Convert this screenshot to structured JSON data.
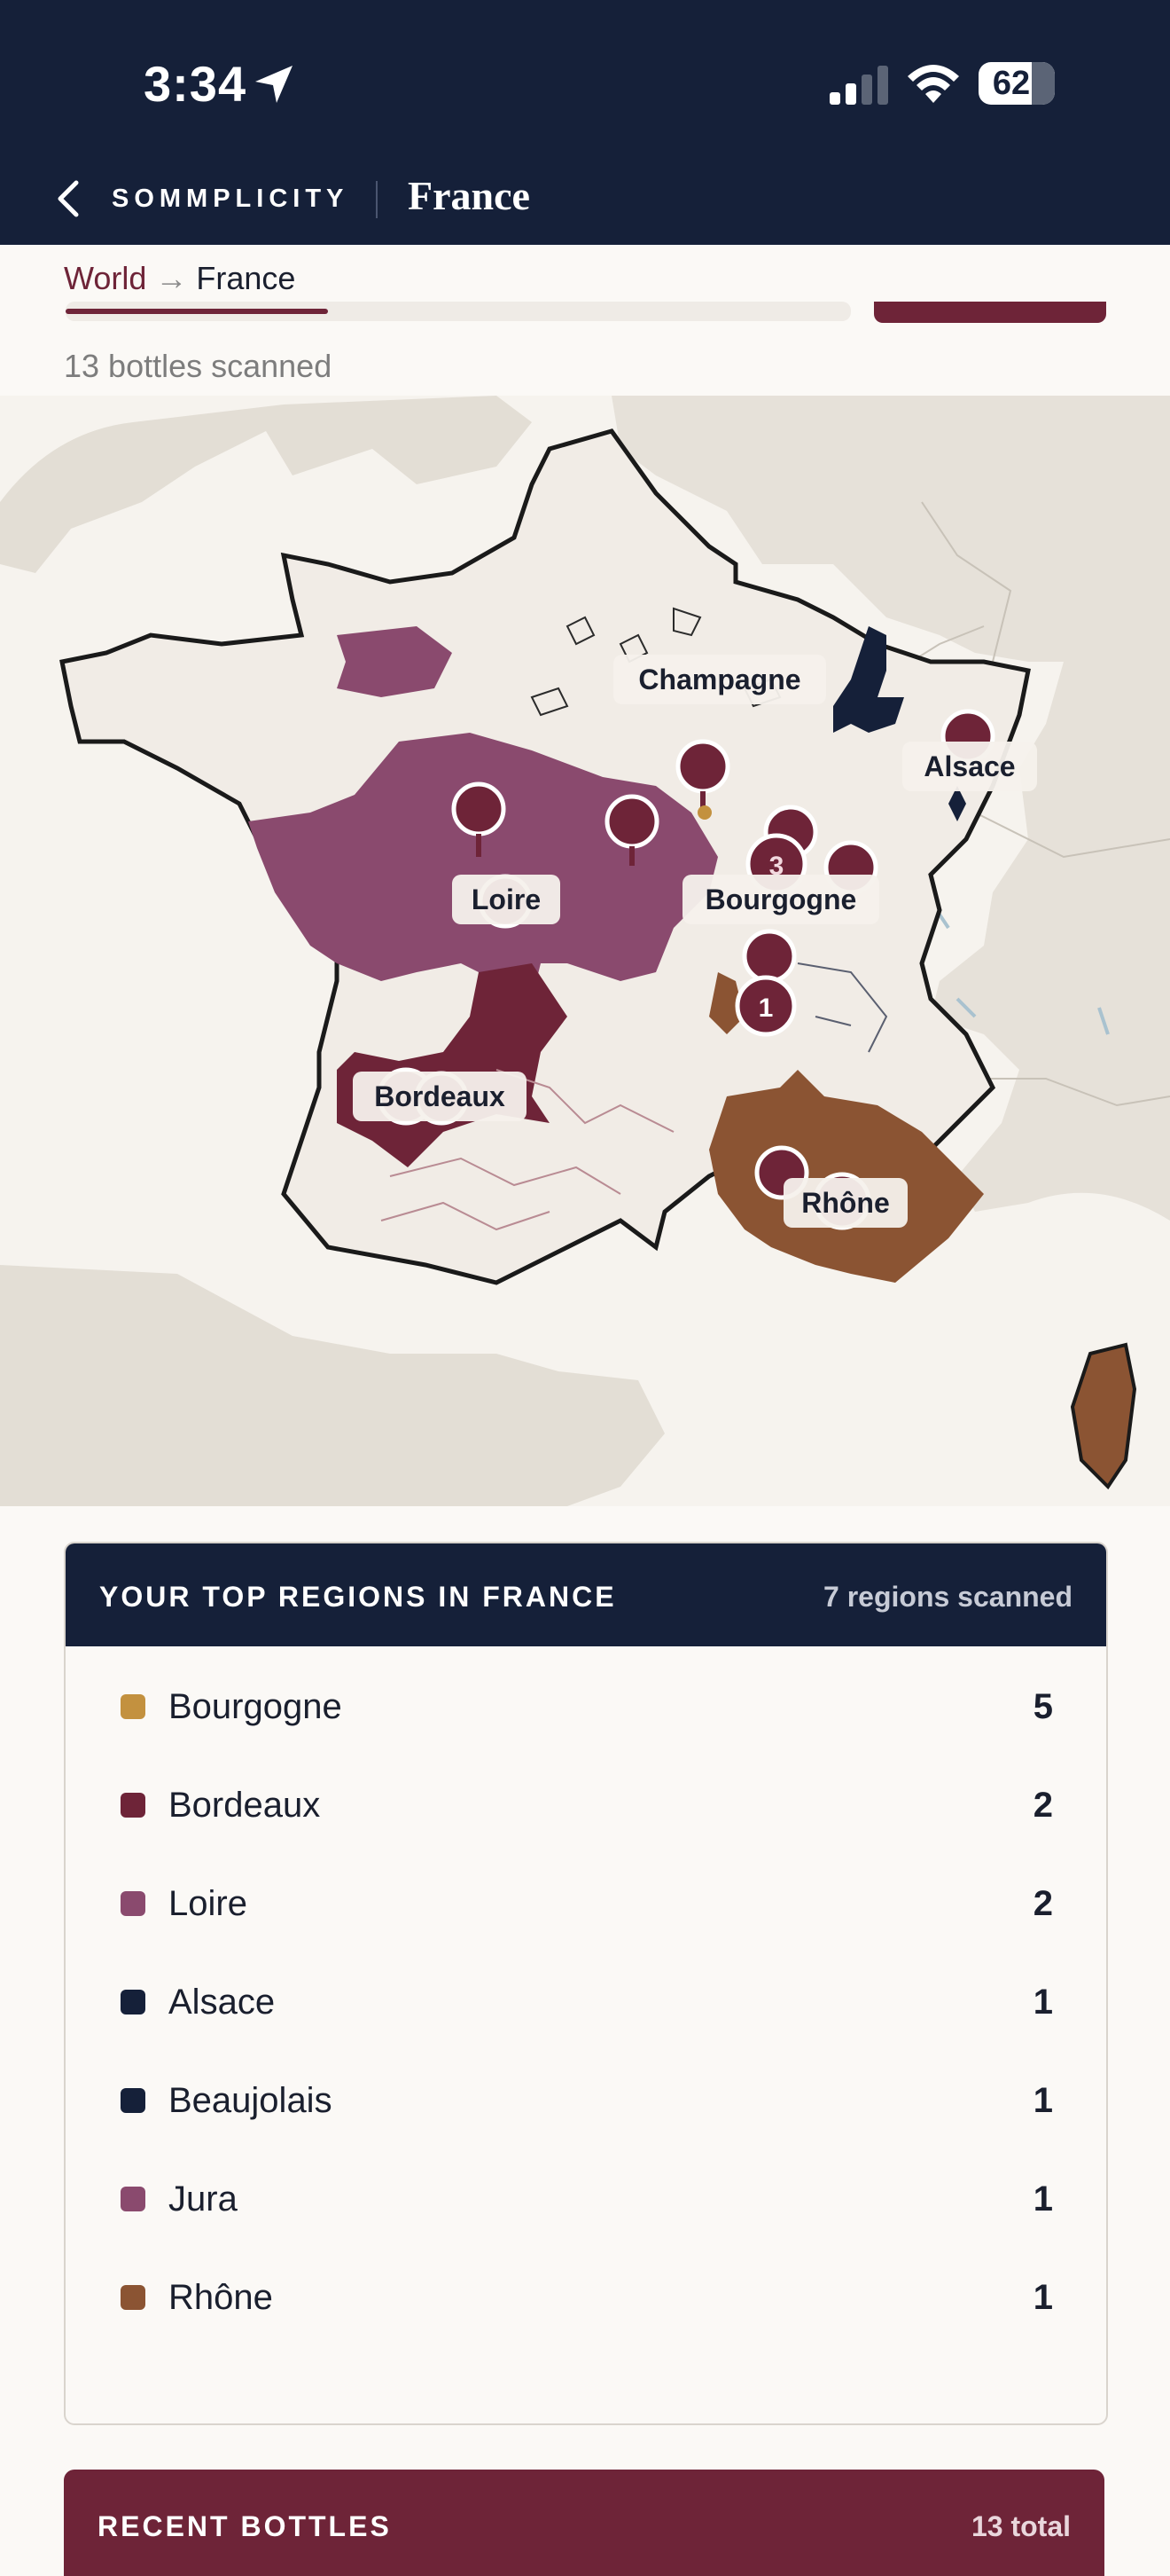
{
  "status_bar": {
    "time": "3:34",
    "battery": "62"
  },
  "nav": {
    "brand": "SOMMPLICITY",
    "title": "France"
  },
  "breadcrumb": {
    "root": "World",
    "separator": "→",
    "current": "France"
  },
  "scan_summary": "13 bottles scanned",
  "map": {
    "labels": [
      "Champagne",
      "Alsace",
      "Loire",
      "Bourgogne",
      "Bordeaux",
      "Rhône"
    ],
    "cluster_counts": [
      "3",
      "1"
    ]
  },
  "top_regions": {
    "title": "YOUR TOP REGIONS IN FRANCE",
    "subtitle": "7 regions scanned",
    "rows": [
      {
        "name": "Bourgogne",
        "count": "5",
        "color": "#c3913f"
      },
      {
        "name": "Bordeaux",
        "count": "2",
        "color": "#6e2438"
      },
      {
        "name": "Loire",
        "count": "2",
        "color": "#8a4a6e"
      },
      {
        "name": "Alsace",
        "count": "1",
        "color": "#152039"
      },
      {
        "name": "Beaujolais",
        "count": "1",
        "color": "#152039"
      },
      {
        "name": "Jura",
        "count": "1",
        "color": "#8a4a6e"
      },
      {
        "name": "Rhône",
        "count": "1",
        "color": "#8b5433"
      }
    ]
  },
  "recent_bottles": {
    "title": "RECENT BOTTLES",
    "total": "13 total"
  },
  "colors": {
    "navy": "#152039",
    "burgundy": "#6e2438",
    "loire": "#8a4a6e",
    "rhone": "#8b5433",
    "bourgogne": "#c3913f"
  }
}
